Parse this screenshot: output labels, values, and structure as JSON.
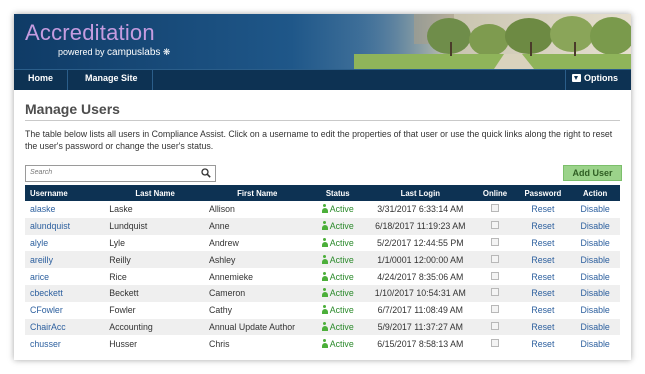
{
  "header": {
    "brand": "Accreditation",
    "powered_by": "powered by",
    "company": "campuslabs"
  },
  "nav": {
    "home": "Home",
    "manage_site": "Manage Site",
    "options": "Options"
  },
  "page": {
    "title": "Manage Users",
    "description": "The table below lists all users in Compliance Assist. Click on a username to edit the properties of that user or use the quick links along the right to reset the user's password or change the user's status.",
    "search_placeholder": "Search",
    "add_user_label": "Add User"
  },
  "table": {
    "columns": [
      "Username",
      "Last Name",
      "First Name",
      "Status",
      "Last Login",
      "Online",
      "Password",
      "Action"
    ],
    "rows": [
      {
        "username": "alaske",
        "last": "Laske",
        "first": "Allison",
        "status": "Active",
        "login": "3/31/2017 6:33:14 AM",
        "password": "Reset",
        "action": "Disable"
      },
      {
        "username": "alundquist",
        "last": "Lundquist",
        "first": "Anne",
        "status": "Active",
        "login": "6/18/2017 11:19:23 AM",
        "password": "Reset",
        "action": "Disable"
      },
      {
        "username": "alyle",
        "last": "Lyle",
        "first": "Andrew",
        "status": "Active",
        "login": "5/2/2017 12:44:55 PM",
        "password": "Reset",
        "action": "Disable"
      },
      {
        "username": "areilly",
        "last": "Reilly",
        "first": "Ashley",
        "status": "Active",
        "login": "1/1/0001 12:00:00 AM",
        "password": "Reset",
        "action": "Disable"
      },
      {
        "username": "arice",
        "last": "Rice",
        "first": "Annemieke",
        "status": "Active",
        "login": "4/24/2017 8:35:06 AM",
        "password": "Reset",
        "action": "Disable"
      },
      {
        "username": "cbeckett",
        "last": "Beckett",
        "first": "Cameron",
        "status": "Active",
        "login": "1/10/2017 10:54:31 AM",
        "password": "Reset",
        "action": "Disable"
      },
      {
        "username": "CFowler",
        "last": "Fowler",
        "first": "Cathy",
        "status": "Active",
        "login": "6/7/2017 11:08:49 AM",
        "password": "Reset",
        "action": "Disable"
      },
      {
        "username": "ChairAcc",
        "last": "Accounting",
        "first": "Annual Update Author",
        "status": "Active",
        "login": "5/9/2017 11:37:27 AM",
        "password": "Reset",
        "action": "Disable"
      },
      {
        "username": "chusser",
        "last": "Husser",
        "first": "Chris",
        "status": "Active",
        "login": "6/15/2017 8:58:13 AM",
        "password": "Reset",
        "action": "Disable"
      }
    ]
  }
}
